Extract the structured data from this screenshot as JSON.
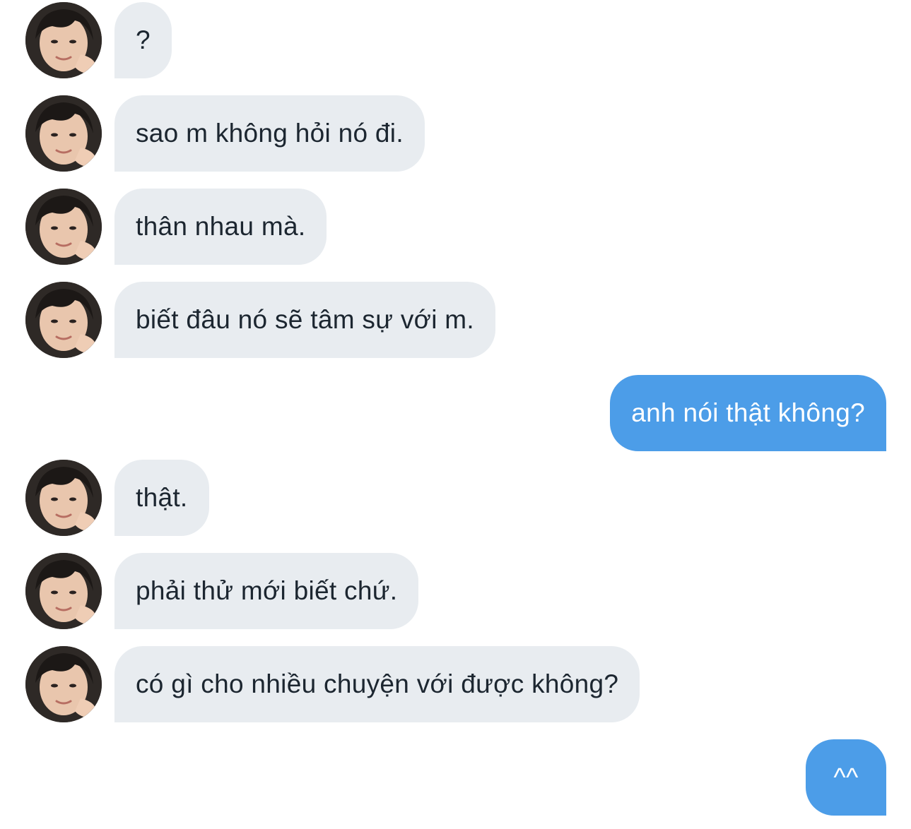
{
  "conversation": {
    "messages": [
      {
        "side": "incoming",
        "text": "?"
      },
      {
        "side": "incoming",
        "text": "sao m không hỏi nó đi."
      },
      {
        "side": "incoming",
        "text": "thân nhau mà."
      },
      {
        "side": "incoming",
        "text": "biết đâu nó sẽ tâm sự với m."
      },
      {
        "side": "outgoing",
        "text": "anh nói thật không?"
      },
      {
        "side": "incoming",
        "text": "thật."
      },
      {
        "side": "incoming",
        "text": "phải thử mới biết chứ."
      },
      {
        "side": "incoming",
        "text": "có gì cho nhiều chuyện với được không?"
      },
      {
        "side": "outgoing",
        "text": "^^"
      }
    ]
  },
  "colors": {
    "incoming_bubble": "#e8ecf0",
    "incoming_text": "#1c2630",
    "outgoing_bubble": "#4c9de8",
    "outgoing_text": "#ffffff",
    "background": "#ffffff"
  },
  "icons": {
    "contact_avatar": "person-photo-avatar"
  }
}
